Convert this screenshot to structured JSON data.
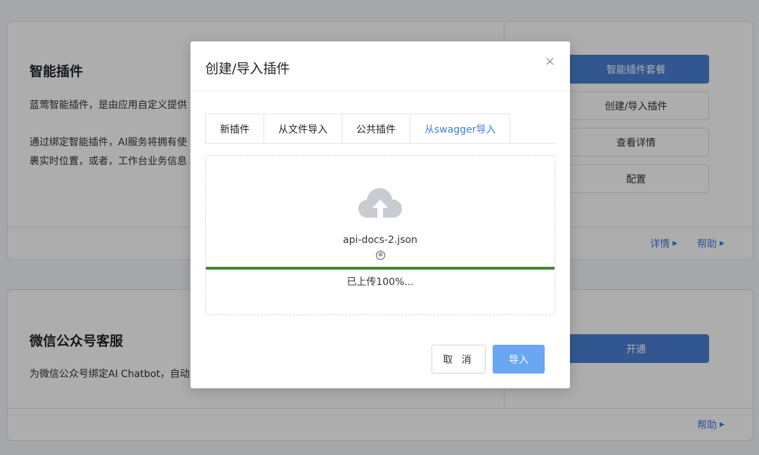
{
  "background": {
    "plugin_card": {
      "title": "智能插件",
      "desc_line1": "蓝莺智能插件，是由应用自定义提供",
      "desc_line2": "通过绑定智能插件，AI服务将拥有使",
      "desc_line3": "裹实时位置，或者，工作台业务信息",
      "buttons": [
        "智能插件套餐",
        "创建/导入插件",
        "查看详情",
        "配置"
      ],
      "links": [
        "详情",
        "帮助"
      ]
    },
    "wechat_card": {
      "title": "微信公众号客服",
      "desc": "为微信公众号绑定AI Chatbot，自动",
      "button": "开通",
      "link": "帮助"
    }
  },
  "modal": {
    "title": "创建/导入插件",
    "close_icon": "×",
    "tabs": [
      "新插件",
      "从文件导入",
      "公共插件",
      "从swagger导入"
    ],
    "active_tab": "从swagger导入",
    "upload": {
      "icon": "cloud-upload-icon",
      "file_name": "api-docs-2.json",
      "remove_icon": "⊗",
      "progress": 1.0,
      "status_text": "已上传100%..."
    },
    "cancel_label": "取 消",
    "import_label": "导入"
  },
  "colors": {
    "primary": "#4a80d4",
    "link": "#3a7ee0",
    "progress": "#3f8a2a",
    "import_button": "#6aa7f3"
  }
}
